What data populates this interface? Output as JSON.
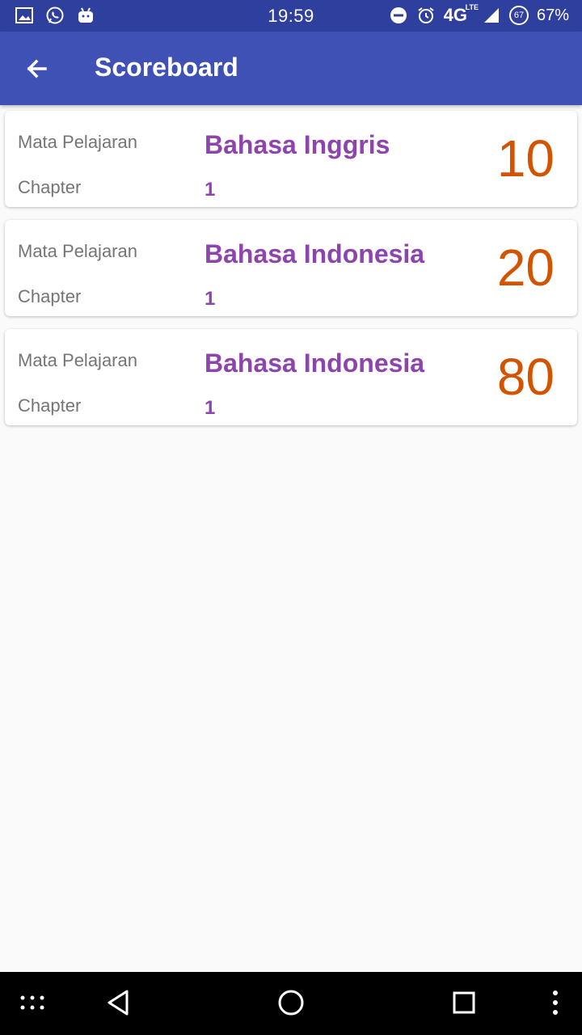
{
  "status_bar": {
    "time": "19:59",
    "network": "4G",
    "network_sub": "LTE",
    "badge": "67",
    "battery": "67%"
  },
  "app_bar": {
    "title": "Scoreboard"
  },
  "scores": [
    {
      "subject_label": "Mata Pelajaran",
      "subject": "Bahasa Inggris",
      "chapter_label": "Chapter",
      "chapter": "1",
      "score": "10"
    },
    {
      "subject_label": "Mata Pelajaran",
      "subject": "Bahasa Indonesia",
      "chapter_label": "Chapter",
      "chapter": "1",
      "score": "20"
    },
    {
      "subject_label": "Mata Pelajaran",
      "subject": "Bahasa Indonesia",
      "chapter_label": "Chapter",
      "chapter": "1",
      "score": "80"
    }
  ],
  "colors": {
    "app_bar": "#3f51b5",
    "status_bar": "#2f3f9e",
    "subject_text": "#8e44ad",
    "score_text": "#d35400"
  }
}
